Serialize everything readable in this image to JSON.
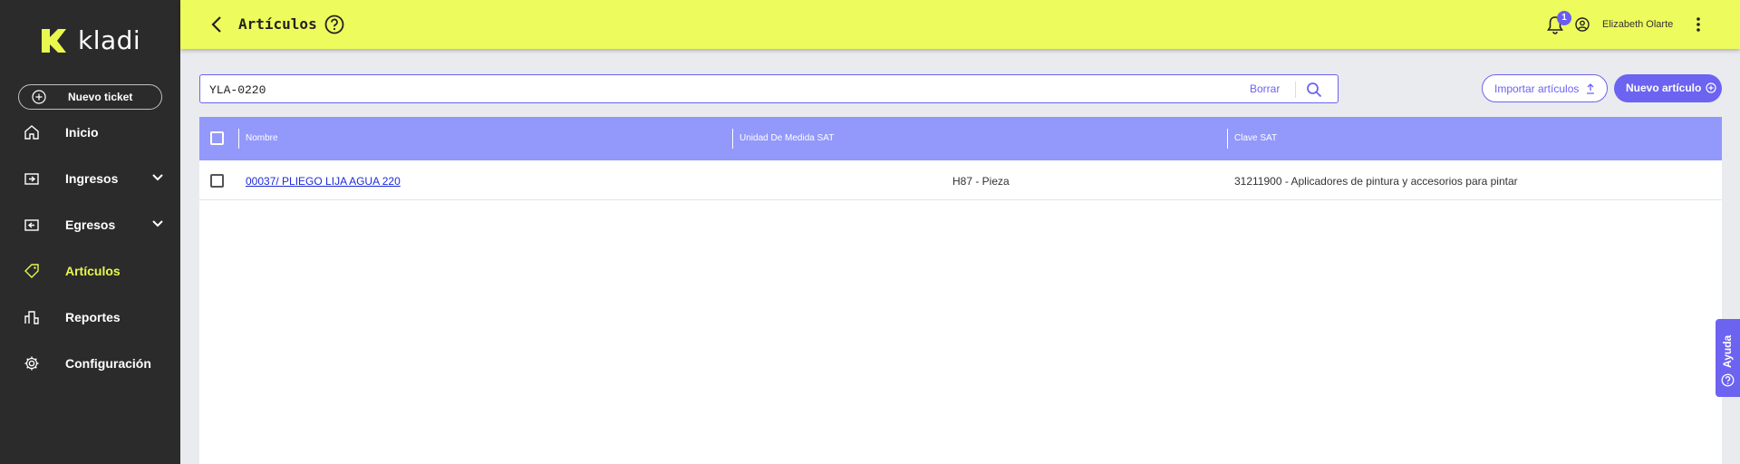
{
  "app": {
    "brand": "kladi"
  },
  "sidebar": {
    "new_ticket": "Nuevo ticket",
    "items": [
      {
        "label": "Inicio"
      },
      {
        "label": "Ingresos"
      },
      {
        "label": "Egresos"
      },
      {
        "label": "Artículos"
      },
      {
        "label": "Reportes"
      },
      {
        "label": "Configuración"
      }
    ]
  },
  "header": {
    "title": "Artículos",
    "notifications": "1",
    "user": "Elizabeth Olarte"
  },
  "search": {
    "value": "YLA-0220",
    "clear": "Borrar"
  },
  "actions": {
    "import": "Importar artículos",
    "new": "Nuevo artículo"
  },
  "table": {
    "columns": [
      "Nombre",
      "Unidad De Medida SAT",
      "Clave SAT"
    ],
    "rows": [
      {
        "name": "00037/ PLIEGO LIJA AGUA 220",
        "unit": "H87 - Pieza",
        "clave": "31211900 - Aplicadores de pintura y accesorios para pintar"
      }
    ]
  },
  "help_tab": {
    "label": "Ayuda"
  },
  "colors": {
    "header": "#eefb5c",
    "sidebar": "#2b2b2b",
    "accent": "#6c63f0",
    "table_header": "#9398fb",
    "active_nav": "#e9f84f"
  }
}
